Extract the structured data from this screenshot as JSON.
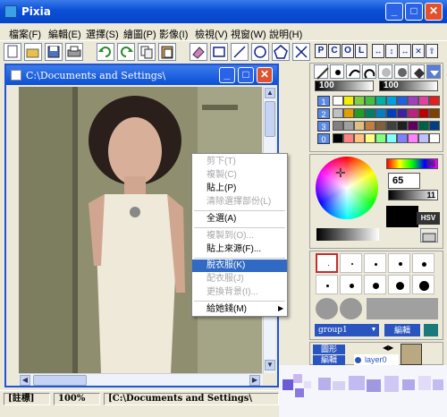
{
  "window": {
    "title": "Pixia"
  },
  "menu": [
    "檔案(F)",
    "編輯(E)",
    "選擇(S)",
    "繪圖(P)",
    "影像(I)",
    "檢視(V)",
    "視窗(W)",
    "說明(H)"
  ],
  "toolbar": {
    "pcol": [
      "P",
      "C",
      "O",
      "L"
    ],
    "nav": [
      "↔",
      "↕",
      "↔",
      "✕",
      "⇧"
    ]
  },
  "doc": {
    "title": "C:\\Documents and Settings\\"
  },
  "context_menu": [
    {
      "label": "剪下(T)",
      "enabled": false
    },
    {
      "label": "複製(C)",
      "enabled": false
    },
    {
      "label": "貼上(P)",
      "enabled": true
    },
    {
      "label": "清除選擇部份(L)",
      "enabled": false
    },
    {
      "label": "全選(A)",
      "enabled": true
    },
    {
      "label": "複製到(O)...",
      "enabled": false
    },
    {
      "label": "貼上來源(F)...",
      "enabled": true
    },
    {
      "label": "脫衣服(K)",
      "enabled": true,
      "highlighted": true
    },
    {
      "label": "配衣服(J)",
      "enabled": false
    },
    {
      "label": "更換背景(I)...",
      "enabled": false
    },
    {
      "label": "給她錢(M)",
      "enabled": true,
      "submenu": true
    }
  ],
  "palette": {
    "counters": [
      "100",
      "100"
    ],
    "row_labels": [
      "1",
      "2",
      "3",
      "0"
    ],
    "rows": [
      [
        "#ffffff",
        "#f0f000",
        "#7fd040",
        "#40c040",
        "#00b0a0",
        "#00a0e0",
        "#2060e0",
        "#a040c0",
        "#e040a0",
        "#e02020"
      ],
      [
        "#c0c0c0",
        "#e0a000",
        "#20a020",
        "#008060",
        "#0080c0",
        "#0040c0",
        "#4020a0",
        "#c02080",
        "#c00000",
        "#804000"
      ],
      [
        "#808080",
        "#a0a0a0",
        "#e0c080",
        "#c08040",
        "#806040",
        "#404040",
        "#202020",
        "#600060",
        "#006040",
        "#004080"
      ],
      [
        "#000000",
        "#ff8080",
        "#ffc080",
        "#ffff80",
        "#80ff80",
        "#80ffff",
        "#8080ff",
        "#ff80ff",
        "#c0c0ff",
        "#ffffff"
      ]
    ]
  },
  "color": {
    "value_top": "96",
    "value_main": "65",
    "value_small": "11",
    "mode": "HSV"
  },
  "brush": {
    "group": "group1",
    "edit": "編輯"
  },
  "layers": {
    "figure_label": "圖形",
    "edit_label": "編輯",
    "layer_name": "layer0"
  },
  "status": {
    "label": "[註標]",
    "zoom": "100%",
    "path": "[C:\\Documents and Settings\\"
  }
}
